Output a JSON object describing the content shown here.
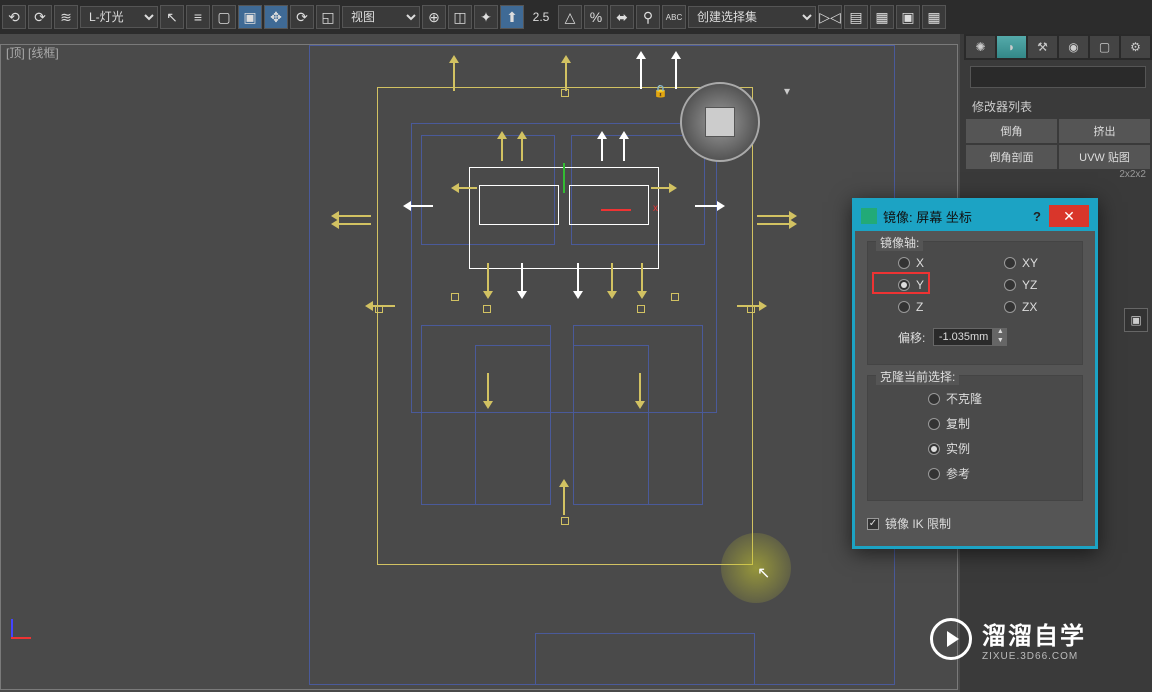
{
  "toolbar": {
    "layer_select": "L-灯光",
    "view_select": "视图",
    "numeric_value": "2.5",
    "selection_set": "创建选择集"
  },
  "viewport": {
    "label_view": "[顶]",
    "label_style": "[线框]",
    "axis_x": "x"
  },
  "rightpanel": {
    "modifier_list": "修改器列表",
    "btn_chamfer": "倒角",
    "btn_extrude": "挤出",
    "btn_chamfer_profile": "倒角剖面",
    "btn_uvw": "UVW 贴图",
    "small_label": "2x2x2"
  },
  "dialog": {
    "title": "镜像: 屏幕 坐标",
    "help": "?",
    "group_axis": "镜像轴:",
    "ax_x": "X",
    "ax_y": "Y",
    "ax_z": "Z",
    "ax_xy": "XY",
    "ax_yz": "YZ",
    "ax_zx": "ZX",
    "offset_label": "偏移:",
    "offset_value": "-1.035mm",
    "group_clone": "克隆当前选择:",
    "opt_noclone": "不克隆",
    "opt_copy": "复制",
    "opt_instance": "实例",
    "opt_reference": "参考",
    "chk_ik": "镜像 IK 限制"
  },
  "watermark": {
    "brand": "溜溜自学",
    "url": "ZIXUE.3D66.COM"
  }
}
